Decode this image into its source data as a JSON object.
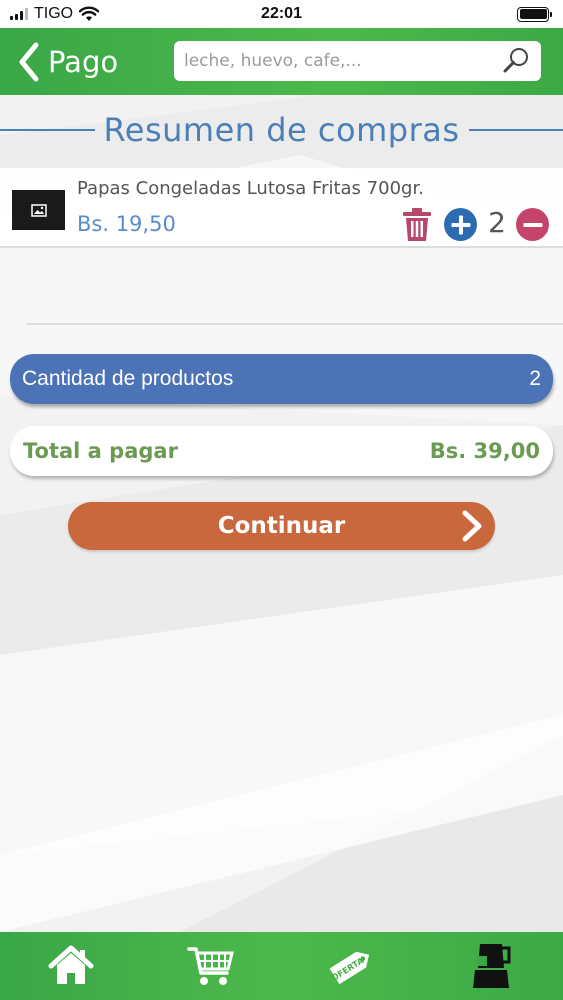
{
  "status_bar": {
    "carrier": "TIGO",
    "time": "22:01"
  },
  "header": {
    "back_label": "Pago",
    "search_placeholder": "leche, huevo, cafe,..."
  },
  "section": {
    "title": "Resumen de compras"
  },
  "cart": {
    "items": [
      {
        "name": "Papas Congeladas Lutosa Fritas 700gr.",
        "price": "Bs. 19,50",
        "quantity": "2"
      }
    ]
  },
  "summary": {
    "quantity_label": "Cantidad de productos",
    "quantity_value": "2",
    "total_label": "Total a pagar",
    "total_value": "Bs. 39,00"
  },
  "actions": {
    "continue_label": "Continuar"
  },
  "bottom_nav": {
    "items": [
      {
        "icon": "home-icon"
      },
      {
        "icon": "cart-icon"
      },
      {
        "icon": "offer-tag-icon",
        "label": "OFERTA"
      },
      {
        "icon": "blender-icon"
      }
    ]
  },
  "colors": {
    "brand_green": "#3aa748",
    "accent_blue": "#4a7fb8",
    "quantity_bar": "#4d73b7",
    "total_text": "#6b9a52",
    "continue_button": "#c9673d",
    "trash": "#b9476a",
    "plus": "#2d6bb0",
    "minus": "#c4446b"
  }
}
